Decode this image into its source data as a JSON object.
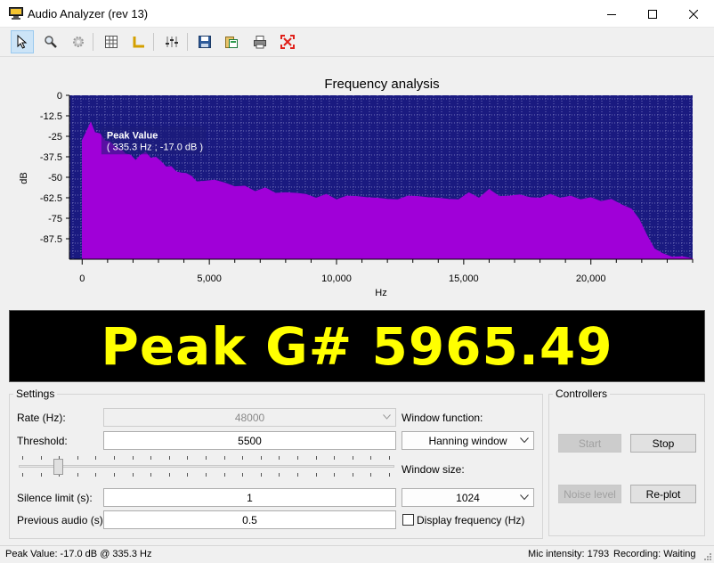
{
  "window": {
    "title": "Audio Analyzer (rev 13)"
  },
  "toolbar": {
    "icons": [
      "pointer-icon",
      "zoom-icon",
      "settings-icon",
      "grid-icon",
      "axes-icon",
      "equalizer-icon",
      "save-icon",
      "copy-icon",
      "print-icon",
      "fit-icon"
    ],
    "active": "pointer-icon"
  },
  "chart_data": {
    "type": "area",
    "title": "Frequency analysis",
    "xlabel": "Hz",
    "ylabel": "dB",
    "xlim": [
      -500,
      24000
    ],
    "ylim": [
      -100,
      0
    ],
    "x_ticks": [
      0,
      5000,
      10000,
      15000,
      20000
    ],
    "x_tick_labels": [
      "0",
      "5,000",
      "10,000",
      "15,000",
      "20,000"
    ],
    "y_ticks": [
      0,
      -12.5,
      -25,
      -37.5,
      -50,
      -62.5,
      -75,
      -87.5
    ],
    "y_tick_labels": [
      "0",
      "-12.5",
      "-25",
      "-37.5",
      "-50",
      "-62.5",
      "-75",
      "-87.5"
    ],
    "grid": true,
    "colors": {
      "background": "#1a1a80",
      "fill": "#a000d8",
      "grid": "#6f6fb8"
    },
    "annotation": {
      "title": "Peak Value",
      "text": "( 335.3 Hz ; -17.0 dB )",
      "x": 335.3,
      "y": -17.0
    },
    "x": [
      0,
      150,
      335,
      500,
      700,
      900,
      1100,
      1300,
      1500,
      1700,
      1900,
      2100,
      2300,
      2500,
      2700,
      2900,
      3100,
      3300,
      3500,
      3700,
      3900,
      4100,
      4300,
      4500,
      4800,
      5200,
      5600,
      6000,
      6400,
      6800,
      7200,
      7600,
      8000,
      8400,
      8800,
      9200,
      9600,
      10000,
      10400,
      10800,
      11200,
      11600,
      12000,
      12400,
      12800,
      13200,
      13600,
      14000,
      14400,
      14800,
      15200,
      15600,
      16000,
      16400,
      16800,
      17200,
      17600,
      18000,
      18400,
      18800,
      19200,
      19600,
      20000,
      20400,
      20800,
      21200,
      21600,
      21900,
      22200,
      22500,
      22800,
      23200,
      23600,
      24000
    ],
    "values": [
      -28,
      -22,
      -17,
      -22,
      -24,
      -27,
      -29,
      -31,
      -33,
      -35,
      -37,
      -39,
      -37,
      -34,
      -39,
      -37,
      -41,
      -43,
      -44,
      -46,
      -48,
      -47,
      -50,
      -52,
      -53,
      -51,
      -54,
      -55,
      -56,
      -58,
      -57,
      -59,
      -60,
      -59,
      -61,
      -62,
      -61,
      -63,
      -62,
      -61,
      -63,
      -62,
      -64,
      -63,
      -62,
      -61,
      -63,
      -62,
      -64,
      -63,
      -60,
      -62,
      -58,
      -61,
      -62,
      -60,
      -63,
      -62,
      -61,
      -62,
      -62,
      -63,
      -63,
      -64,
      -64,
      -66,
      -70,
      -75,
      -86,
      -93,
      -97,
      -98,
      -99,
      -99
    ]
  },
  "peak_display": {
    "text": "Peak G# 5965.49",
    "color": "#ffff00"
  },
  "settings": {
    "title": "Settings",
    "rate_label": "Rate (Hz):",
    "rate_value": "48000",
    "threshold_label": "Threshold:",
    "threshold_value": "5500",
    "threshold_slider": 0.1,
    "silence_label": "Silence limit (s):",
    "silence_value": "1",
    "previous_label": "Previous audio (s):",
    "previous_value": "0.5",
    "window_function_label": "Window function:",
    "window_function_value": "Hanning window",
    "window_size_label": "Window size:",
    "window_size_value": "1024",
    "display_frequency_label": "Display frequency (Hz)",
    "display_frequency_checked": false
  },
  "controllers": {
    "title": "Controllers",
    "start": "Start",
    "stop": "Stop",
    "noise": "Noise level",
    "replot": "Re-plot"
  },
  "status": {
    "left": "Peak Value: -17.0 dB @ 335.3 Hz",
    "mic": "Mic intensity: 1793",
    "recording": "Recording: Waiting"
  }
}
